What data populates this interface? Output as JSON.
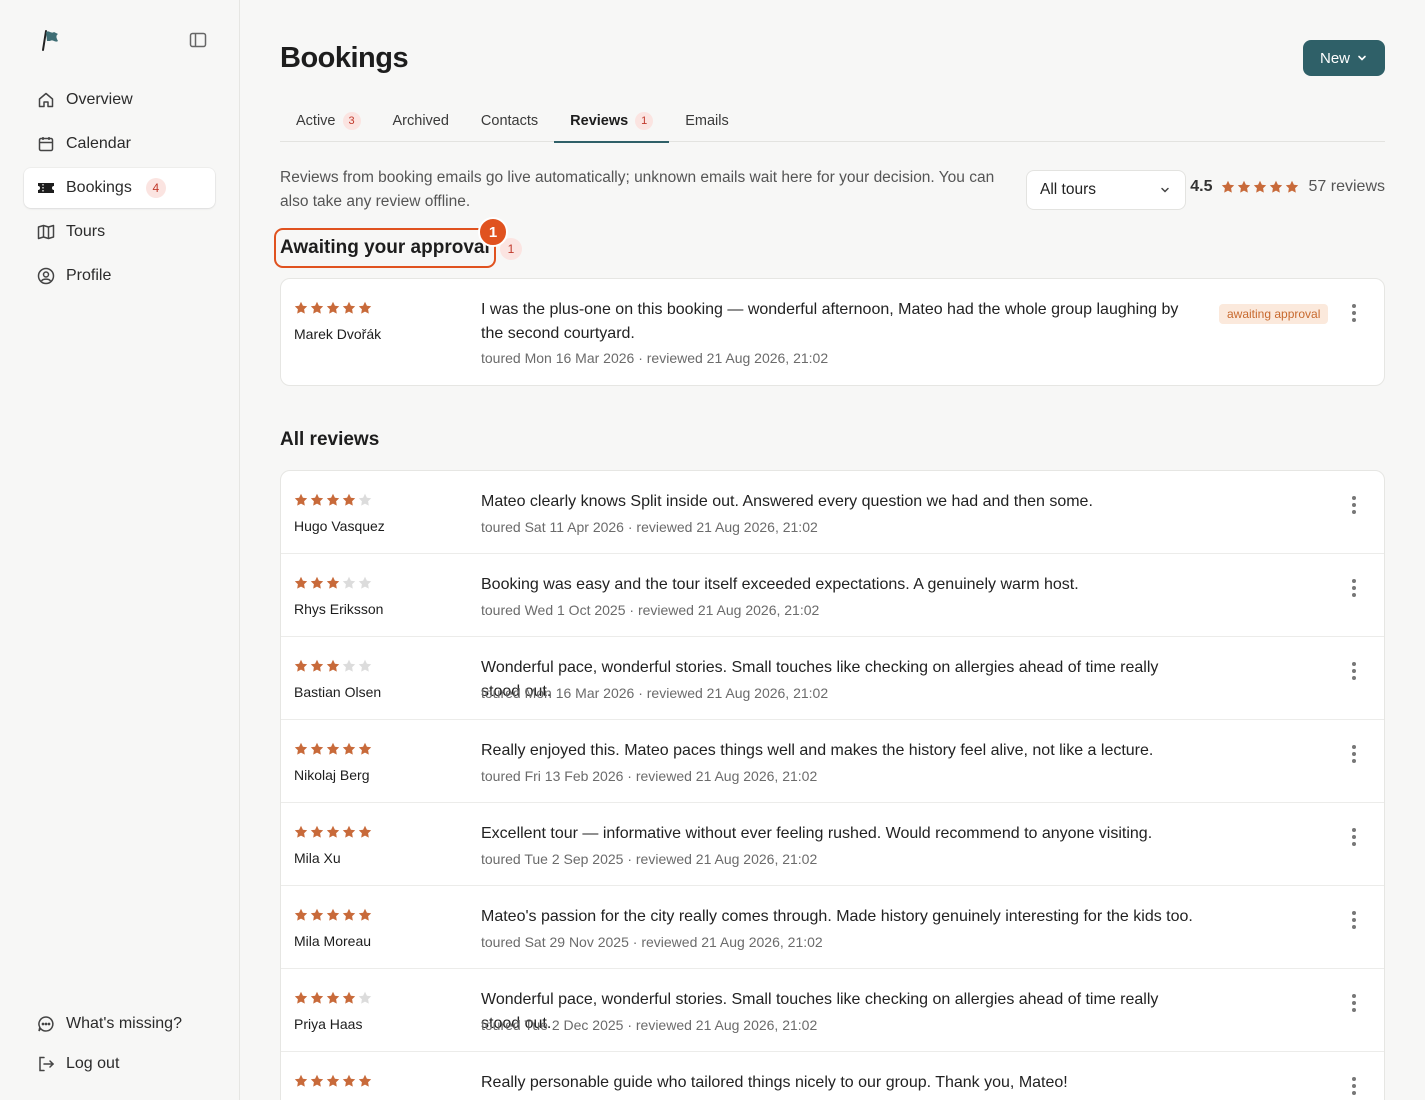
{
  "sidebar": {
    "items": [
      {
        "label": "Overview",
        "icon": "home-icon"
      },
      {
        "label": "Calendar",
        "icon": "calendar-icon"
      },
      {
        "label": "Bookings",
        "icon": "ticket-icon",
        "badge": "4"
      },
      {
        "label": "Tours",
        "icon": "map-icon"
      },
      {
        "label": "Profile",
        "icon": "user-circle-icon"
      }
    ],
    "bottom": [
      {
        "label": "What's missing?",
        "icon": "chat-icon"
      },
      {
        "label": "Log out",
        "icon": "logout-icon"
      }
    ]
  },
  "header": {
    "title": "Bookings",
    "new_label": "New"
  },
  "tabs": [
    {
      "label": "Active",
      "badge": "3"
    },
    {
      "label": "Archived"
    },
    {
      "label": "Contacts"
    },
    {
      "label": "Reviews",
      "badge": "1"
    },
    {
      "label": "Emails"
    }
  ],
  "intro": "Reviews from booking emails go live automatically; unknown emails wait here for your decision. You can also take any review offline.",
  "filter": {
    "selected": "All tours"
  },
  "summary": {
    "average": "4.5",
    "average_stars": 4.5,
    "count": "57 reviews"
  },
  "approval": {
    "heading": "Awaiting your approval",
    "notification": "1",
    "count": "1",
    "items": [
      {
        "rating": 5,
        "name": "Marek Dvořák",
        "text": "I was the plus-one on this booking — wonderful afternoon, Mateo had the whole group laughing by the second courtyard.",
        "meta": "toured Mon 16 Mar 2026 · reviewed 21 Aug 2026, 21:02",
        "status": "awaiting approval"
      }
    ]
  },
  "all_reviews": {
    "heading": "All reviews",
    "items": [
      {
        "rating": 4,
        "name": "Hugo Vasquez",
        "text": "Mateo clearly knows Split inside out. Answered every question we had and then some.",
        "meta": "toured Sat 11 Apr 2026 · reviewed 21 Aug 2026, 21:02"
      },
      {
        "rating": 3,
        "name": "Rhys Eriksson",
        "text": "Booking was easy and the tour itself exceeded expectations. A genuinely warm host.",
        "meta": "toured Wed 1 Oct 2025 · reviewed 21 Aug 2026, 21:02"
      },
      {
        "rating": 3,
        "name": "Bastian Olsen",
        "text": "Wonderful pace, wonderful stories. Small touches like checking on allergies ahead of time really stood out.",
        "meta": "toured Mon 16 Mar 2026 · reviewed 21 Aug 2026, 21:02"
      },
      {
        "rating": 5,
        "name": "Nikolaj Berg",
        "text": "Really enjoyed this. Mateo paces things well and makes the history feel alive, not like a lecture.",
        "meta": "toured Fri 13 Feb 2026 · reviewed 21 Aug 2026, 21:02"
      },
      {
        "rating": 5,
        "name": "Mila Xu",
        "text": "Excellent tour — informative without ever feeling rushed. Would recommend to anyone visiting.",
        "meta": "toured Tue 2 Sep 2025 · reviewed 21 Aug 2026, 21:02"
      },
      {
        "rating": 5,
        "name": "Mila Moreau",
        "text": "Mateo's passion for the city really comes through. Made history genuinely interesting for the kids too.",
        "meta": "toured Sat 29 Nov 2025 · reviewed 21 Aug 2026, 21:02"
      },
      {
        "rating": 4,
        "name": "Priya Haas",
        "text": "Wonderful pace, wonderful stories. Small touches like checking on allergies ahead of time really stood out.",
        "meta": "toured Tue 2 Dec 2025 · reviewed 21 Aug 2026, 21:02"
      },
      {
        "rating": 5,
        "name": "",
        "text": "Really personable guide who tailored things nicely to our group. Thank you, Mateo!",
        "meta": ""
      }
    ]
  },
  "colors": {
    "accent": "#2f6068",
    "star": "#c86a3a",
    "star_empty": "#dcdcdc",
    "alert": "#e0521f"
  }
}
